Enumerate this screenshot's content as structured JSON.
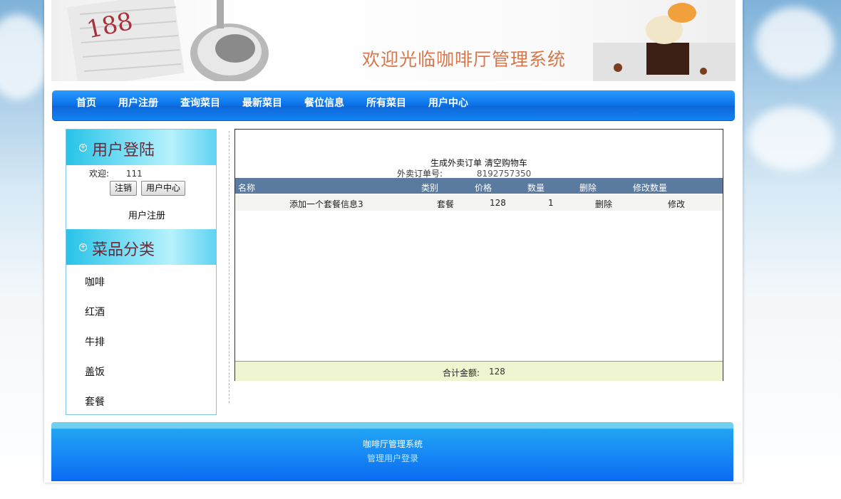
{
  "banner": {
    "title": "欢迎光临咖啡厅管理系统"
  },
  "nav": {
    "items": [
      "首页",
      "用户注册",
      "查询菜目",
      "最新菜目",
      "餐位信息",
      "所有菜目",
      "用户中心"
    ]
  },
  "login": {
    "title": "用户登陆",
    "welcome_label": "欢迎:",
    "username": "111",
    "logout_button": "注销",
    "user_center_button": "用户中心",
    "register_link": "用户注册"
  },
  "categories": {
    "title": "菜品分类",
    "items": [
      "咖啡",
      "红酒",
      "牛排",
      "盖饭",
      "套餐"
    ]
  },
  "cart": {
    "generate_order": "生成外卖订单",
    "clear_cart": "清空购物车",
    "order_no_label": "外卖订单号:",
    "order_no": "8192757350",
    "columns": [
      "名称",
      "类别",
      "价格",
      "数量",
      "删除",
      "修改数量"
    ],
    "rows": [
      {
        "name": "添加一个套餐信息3",
        "category": "套餐",
        "price": "128",
        "qty": "1",
        "delete": "删除",
        "modify": "修改"
      }
    ],
    "total_label": "合计金额:",
    "total": "128"
  },
  "footer": {
    "system_name": "咖啡厅管理系统",
    "admin_login": "管理用户登录"
  },
  "colors": {
    "nav": "#0a72e9",
    "table_header": "#5a7aa0",
    "total_row": "#eff5d0",
    "banner_title": "#d9774a"
  }
}
